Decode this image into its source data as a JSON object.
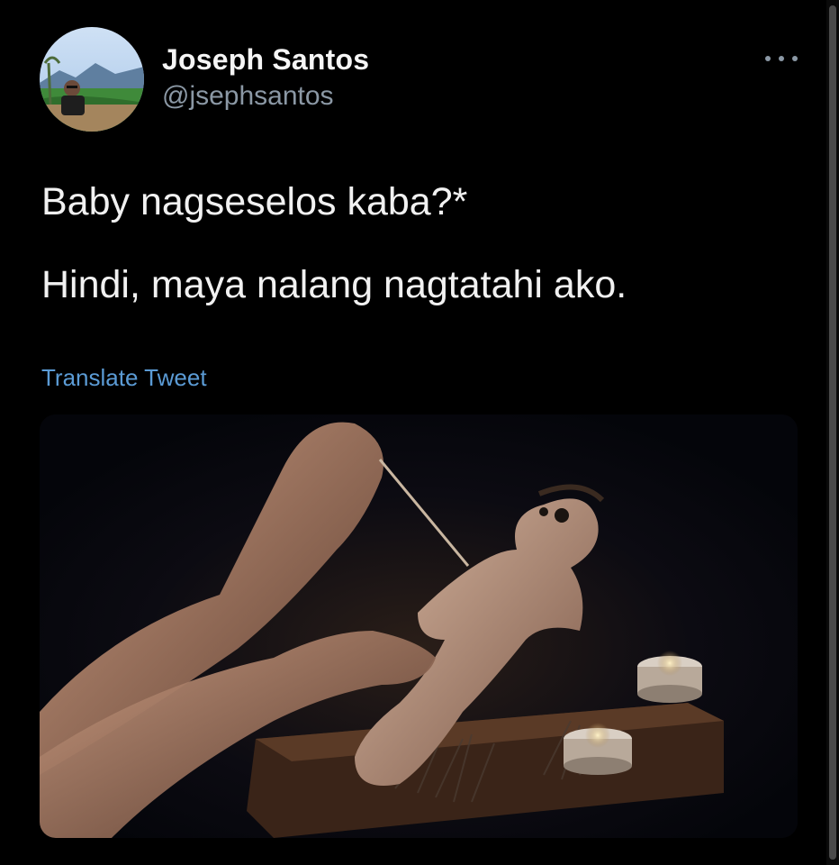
{
  "tweet": {
    "author": {
      "name": "Joseph Santos",
      "handle": "@jsephsantos"
    },
    "text_lines": [
      "Baby nagseselos kaba?*",
      "Hindi, maya nalang nagtatahi ako."
    ],
    "translate_label": "Translate Tweet",
    "more_icon": "more-horizontal-icon",
    "media": {
      "type": "photo"
    }
  },
  "colors": {
    "background": "#000000",
    "text": "#f1f1f1",
    "secondary": "#8b98a5",
    "link": "#5b9bd5"
  }
}
